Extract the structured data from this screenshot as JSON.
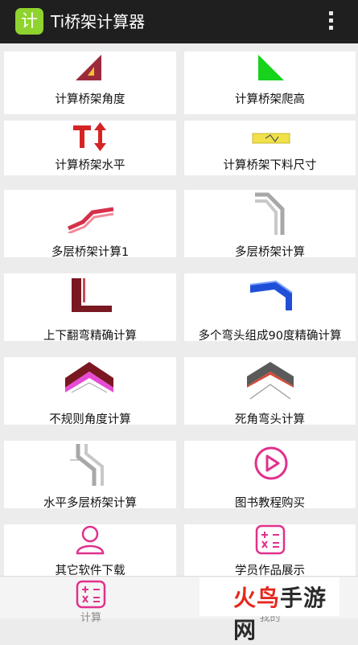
{
  "app": {
    "logo_char": "计",
    "title": "Ti桥架计算器",
    "accent": "#8fd32e",
    "bar_color": "#1f1f1f"
  },
  "menu": {
    "icon": "more-vertical-icon"
  },
  "tiles": [
    {
      "label": "计算桥架角度",
      "icon": "triangle-angle-icon"
    },
    {
      "label": "计算桥架爬高",
      "icon": "green-triangle-icon"
    },
    {
      "label": "计算桥架水平",
      "icon": "T-arrow-icon"
    },
    {
      "label": "计算桥架下料尺寸",
      "icon": "tray-cut-icon"
    },
    {
      "label": "多层桥架计算1",
      "icon": "multi-layer-tray-icon"
    },
    {
      "label": "多层桥架计算",
      "icon": "multi-layer-bend-icon"
    },
    {
      "label": "上下翻弯精确计算",
      "icon": "up-down-bend-icon"
    },
    {
      "label": "多个弯头组成90度精确计算",
      "icon": "elbow-90-icon"
    },
    {
      "label": "不规则角度计算",
      "icon": "irregular-angle-icon"
    },
    {
      "label": "死角弯头计算",
      "icon": "dead-corner-elbow-icon"
    },
    {
      "label": "水平多层桥架计算",
      "icon": "horizontal-multi-tray-icon"
    },
    {
      "label": "图书教程购买",
      "icon": "play-icon"
    },
    {
      "label": "其它软件下载",
      "icon": "user-icon"
    },
    {
      "label": "学员作品展示",
      "icon": "calculator-icon"
    }
  ],
  "tabs": [
    {
      "label": "计算",
      "icon": "calculator-icon"
    },
    {
      "label": "我的",
      "icon": "user-icon"
    }
  ],
  "watermark": {
    "brand_red": "火鸟",
    "brand_dark": "手游网"
  }
}
